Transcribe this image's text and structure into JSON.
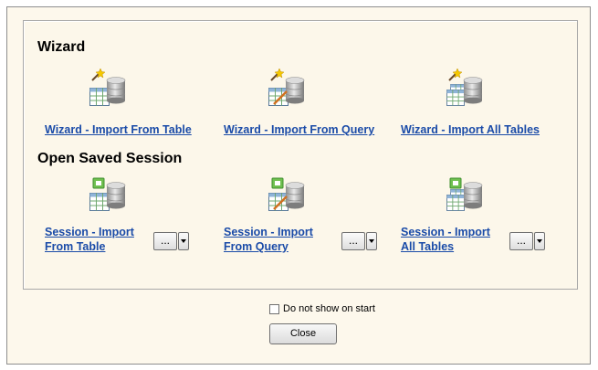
{
  "wizard": {
    "title": "Wizard",
    "items": [
      {
        "label": "Wizard - Import From Table",
        "icon": "wizard-table-db-icon"
      },
      {
        "label": "Wizard - Import From Query",
        "icon": "wizard-query-db-icon"
      },
      {
        "label": "Wizard - Import All Tables",
        "icon": "wizard-all-tables-db-icon"
      }
    ]
  },
  "session": {
    "title": "Open Saved Session",
    "items": [
      {
        "label_line1": "Session - Import",
        "label_line2": "From Table",
        "button": "...",
        "icon": "session-table-db-icon"
      },
      {
        "label_line1": "Session - Import",
        "label_line2": "From Query",
        "button": "...",
        "icon": "session-query-db-icon"
      },
      {
        "label_line1": "Session - Import",
        "label_line2": "All Tables",
        "button": "...",
        "icon": "session-all-tables-db-icon"
      }
    ]
  },
  "footer": {
    "checkbox_label": "Do not show on start",
    "close_label": "Close"
  },
  "colors": {
    "link": "#1a4ba8",
    "background": "#fdf8ec"
  }
}
